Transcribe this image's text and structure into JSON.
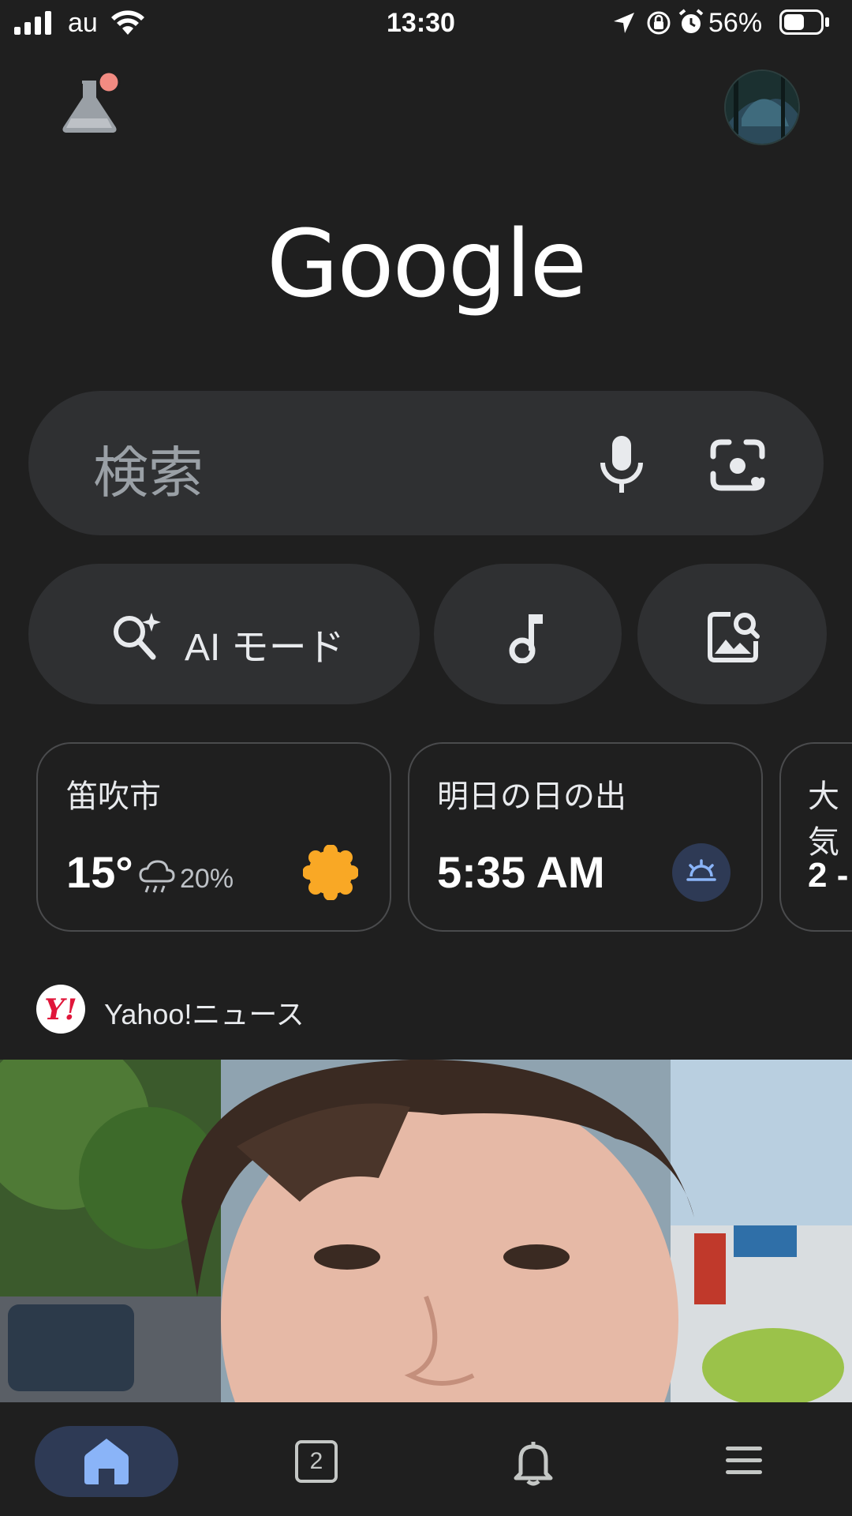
{
  "status_bar": {
    "carrier": "au",
    "time": "13:30",
    "battery_percent": "56%",
    "battery_level": 0.56
  },
  "header": {
    "labs_icon": "flask-icon",
    "avatar_icon": "account-avatar"
  },
  "logo": {
    "text": "Google"
  },
  "search": {
    "placeholder": "検索",
    "mic_icon": "microphone-icon",
    "lens_icon": "google-lens-icon"
  },
  "quick_actions": {
    "ai_mode_label": "AI モード",
    "music_icon": "music-note-icon",
    "image_search_icon": "image-search-icon"
  },
  "cards": [
    {
      "title": "笛吹市",
      "temp": "15°",
      "rain_chance": "20%",
      "icon": "sun-icon"
    },
    {
      "title": "明日の日の出",
      "value": "5:35 AM",
      "icon": "sunrise-icon"
    },
    {
      "title": "大気",
      "value": "2 -"
    }
  ],
  "news": {
    "source": "Yahoo!ニュース",
    "source_logo_text": "Y!"
  },
  "bottom_nav": {
    "home_icon": "home-icon",
    "tab_count": "2",
    "notifications_icon": "bell-icon",
    "menu_icon": "hamburger-menu-icon"
  },
  "colors": {
    "background": "#1f1f1f",
    "surface": "#2f3032",
    "accent": "#8ab4f8",
    "sun": "#f9a825"
  }
}
